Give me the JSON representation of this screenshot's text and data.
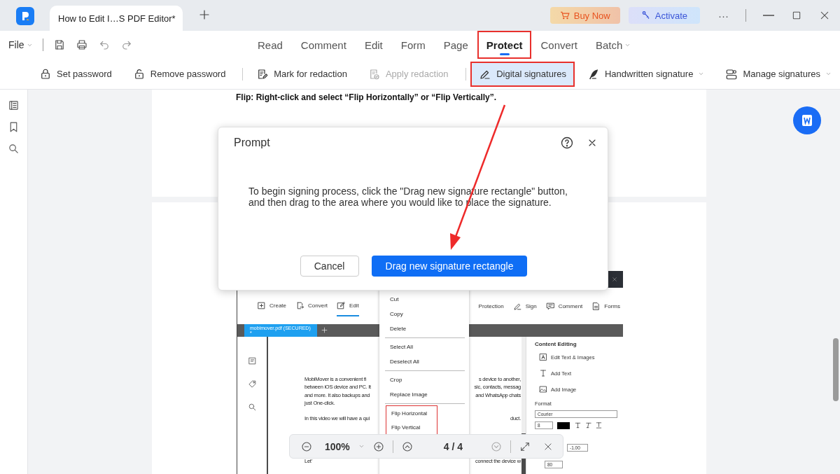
{
  "app": {
    "tab_title": "How to Edit I…S PDF Editor*",
    "buy_now": "Buy Now",
    "activate": "Activate",
    "more": "···"
  },
  "menu_bar": {
    "file": "File",
    "tabs": [
      {
        "label": "Read",
        "selected": false,
        "highlighted": false,
        "dropdown": false
      },
      {
        "label": "Comment",
        "selected": false,
        "highlighted": false,
        "dropdown": false
      },
      {
        "label": "Edit",
        "selected": false,
        "highlighted": false,
        "dropdown": false
      },
      {
        "label": "Form",
        "selected": false,
        "highlighted": false,
        "dropdown": false
      },
      {
        "label": "Page",
        "selected": false,
        "highlighted": false,
        "dropdown": false
      },
      {
        "label": "Protect",
        "selected": true,
        "highlighted": true,
        "dropdown": false
      },
      {
        "label": "Convert",
        "selected": false,
        "highlighted": false,
        "dropdown": false
      },
      {
        "label": "Batch",
        "selected": false,
        "highlighted": false,
        "dropdown": true
      }
    ]
  },
  "toolbar": [
    {
      "label": "Set password",
      "disabled": false,
      "selected": false,
      "highlighted": false,
      "dropdown": false,
      "separator_after": false
    },
    {
      "label": "Remove password",
      "disabled": false,
      "selected": false,
      "highlighted": false,
      "dropdown": false,
      "separator_after": true
    },
    {
      "label": "Mark for redaction",
      "disabled": false,
      "selected": false,
      "highlighted": false,
      "dropdown": false,
      "separator_after": false
    },
    {
      "label": "Apply redaction",
      "disabled": true,
      "selected": false,
      "highlighted": false,
      "dropdown": false,
      "separator_after": true
    },
    {
      "label": "Digital signatures",
      "disabled": false,
      "selected": true,
      "highlighted": true,
      "dropdown": false,
      "separator_after": false
    },
    {
      "label": "Handwritten signature",
      "disabled": false,
      "selected": false,
      "highlighted": false,
      "dropdown": true,
      "separator_after": false
    },
    {
      "label": "Manage signatures",
      "disabled": false,
      "selected": false,
      "highlighted": false,
      "dropdown": true,
      "separator_after": false
    }
  ],
  "document": {
    "heading": "Flip: Right-click and select “Flip Horizontally” or “Flip Vertically”."
  },
  "dialog": {
    "title": "Prompt",
    "message": "To begin signing process, click the \"Drag new signature rectangle\" button, and then drag to the area where you would like to place the signature.",
    "cancel": "Cancel",
    "confirm": "Drag new signature rectangle"
  },
  "embedded": {
    "toolbar_left": [
      {
        "label": "Create",
        "selected": false
      },
      {
        "label": "Convert",
        "selected": false
      },
      {
        "label": "Edit",
        "selected": true
      }
    ],
    "toolbar_right": [
      {
        "label": "Protection",
        "selected": false
      },
      {
        "label": "Sign",
        "selected": false
      },
      {
        "label": "Comment",
        "selected": false
      },
      {
        "label": "Forms",
        "selected": false
      }
    ],
    "file_tab": "mobimover.pdf (SECURED) *",
    "paragraphs": [
      [
        {
          "left": "MobiMover is a convenient fi",
          "right": "s device to another,"
        },
        {
          "left": "between iOS device and PC. It",
          "right": "sic, contacts, messag"
        },
        {
          "left": "and more. It also backups and",
          "right": "and WhatsApp chats"
        },
        {
          "left": "just One-click."
        }
      ],
      [
        {
          "left": "In this video we will have a qui",
          "right": "duct."
        }
      ]
    ],
    "lower_lines": [
      {
        "left": "Let'",
        "right": "connect the device w"
      }
    ],
    "context_menu": [
      {
        "kind": "item",
        "label": "Cut"
      },
      {
        "kind": "item",
        "label": "Copy"
      },
      {
        "kind": "item",
        "label": "Delete"
      },
      {
        "kind": "separator"
      },
      {
        "kind": "item",
        "label": "Select All"
      },
      {
        "kind": "item",
        "label": "Deselect All"
      },
      {
        "kind": "separator"
      },
      {
        "kind": "item",
        "label": "Crop"
      },
      {
        "kind": "item",
        "label": "Replace Image"
      },
      {
        "kind": "separator"
      },
      {
        "kind": "highlight",
        "items": [
          "Flip Horizontal",
          "Flip Vertical"
        ]
      }
    ],
    "panel": {
      "section": "Content Editing",
      "tools": [
        "Edit Text & Images",
        "Add Text",
        "Add Image"
      ],
      "format": "Format",
      "font": "Courier",
      "size": "8",
      "spacing": "-1.00",
      "scale": "80"
    }
  },
  "zoom_bar": {
    "zoom": "100%",
    "page": "4 / 4"
  }
}
